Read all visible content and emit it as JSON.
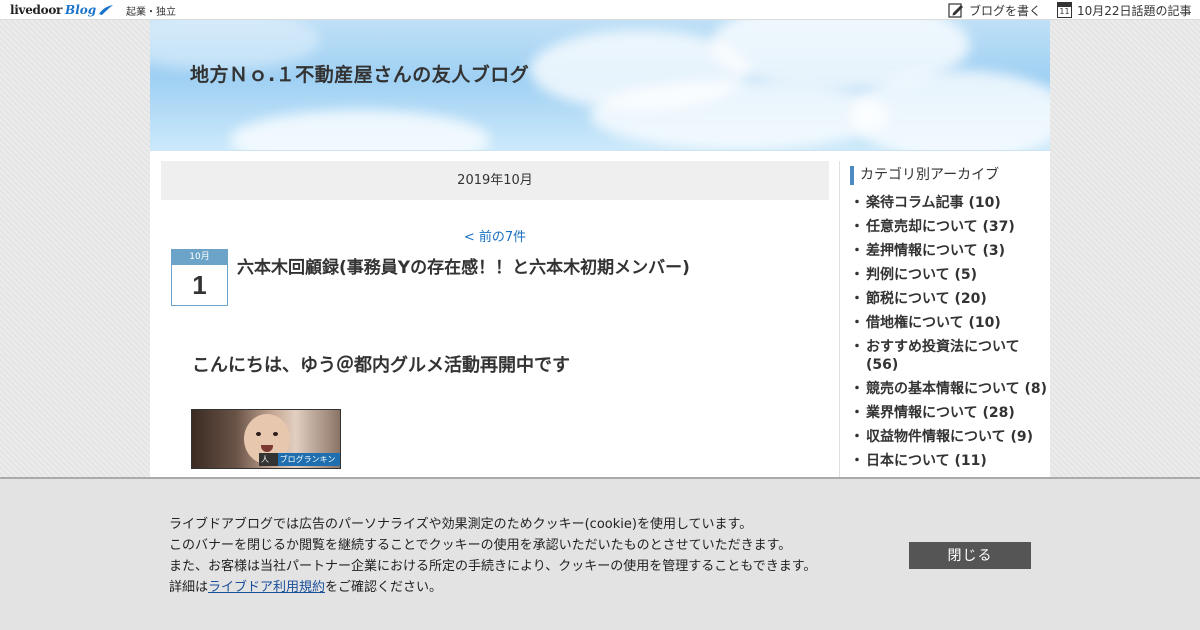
{
  "topbar": {
    "logo_main": "livedoor",
    "logo_sub": "Blog",
    "tagline": "起業・独立",
    "write_label": "ブログを書く",
    "topic_label": "10月22日話題の記事",
    "calendar_day": "11"
  },
  "header": {
    "blog_title": "地方Ｎｏ.１不動産屋さんの友人ブログ"
  },
  "main": {
    "month": "2019年10月",
    "prev_link": "< 前の7件",
    "date_month": "10月",
    "date_day": "1",
    "article_title": "六本木回顧録(事務員Yの存在感！！と六本木初期メンバー)",
    "greeting": "こんにちは、ゆう＠都内グルメ活動再開中です",
    "banner_label_1": "人気",
    "banner_label_2": "ブログランキング"
  },
  "sidebar": {
    "title": "カテゴリ別アーカイブ",
    "categories": [
      {
        "label": "楽待コラム記事 (10)"
      },
      {
        "label": "任意売却について (37)"
      },
      {
        "label": "差押情報について (3)"
      },
      {
        "label": "判例について (5)"
      },
      {
        "label": "節税について (20)"
      },
      {
        "label": "借地権について (10)"
      },
      {
        "label": "おすすめ投資法について (56)"
      },
      {
        "label": "競売の基本情報について (8)"
      },
      {
        "label": "業界情報について (28)"
      },
      {
        "label": "収益物件情報について (9)"
      },
      {
        "label": "日本について (11)"
      }
    ]
  },
  "cookie": {
    "line1": "ライブドアブログでは広告のパーソナライズや効果測定のためクッキー(cookie)を使用しています。",
    "line2": "このバナーを閉じるか閲覧を継続することでクッキーの使用を承認いただいたものとさせていただきます。",
    "line3": "また、お客様は当社パートナー企業における所定の手続きにより、クッキーの使用を管理することもできます。",
    "line4_prefix": "詳細は",
    "line4_link": "ライブドア利用規約",
    "line4_suffix": "をご確認ください。",
    "close_label": "閉じる"
  }
}
